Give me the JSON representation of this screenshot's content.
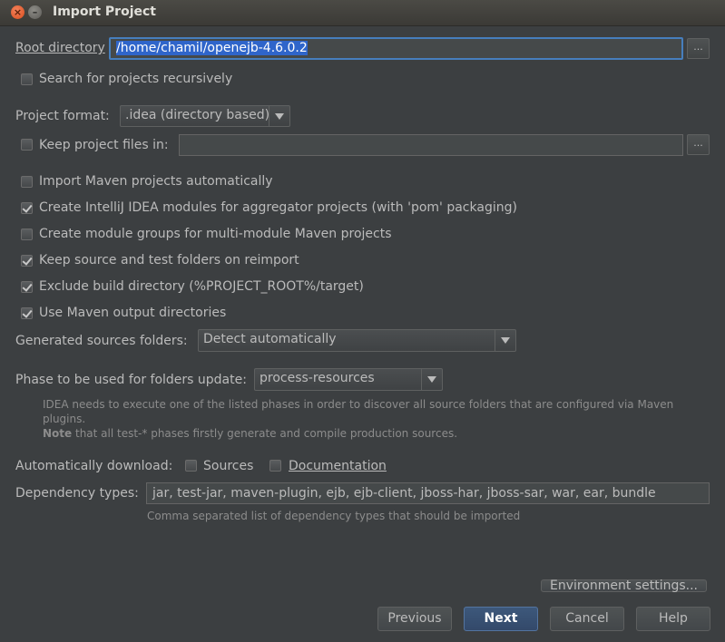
{
  "window": {
    "title": "Import Project"
  },
  "root_directory": {
    "label": "Root directory",
    "value": "/home/chamil/openejb-4.6.0.2",
    "browse_label": "..."
  },
  "search_recursively": {
    "label": "Search for projects recursively",
    "checked": false
  },
  "project_format": {
    "label": "Project format:",
    "selected": ".idea (directory based)"
  },
  "keep_project_files": {
    "label": "Keep project files in:",
    "checked": false,
    "value": "",
    "browse_label": "..."
  },
  "maven_options": [
    {
      "label": "Import Maven projects automatically",
      "checked": false
    },
    {
      "label": "Create IntelliJ IDEA modules for aggregator projects (with 'pom' packaging)",
      "checked": true
    },
    {
      "label": "Create module groups for multi-module Maven projects",
      "checked": false
    },
    {
      "label": "Keep source and test folders on reimport",
      "checked": true
    },
    {
      "label": "Exclude build directory (%PROJECT_ROOT%/target)",
      "checked": true
    },
    {
      "label": "Use Maven output directories",
      "checked": true
    }
  ],
  "generated_sources": {
    "label": "Generated sources folders:",
    "selected": "Detect automatically"
  },
  "phase": {
    "label": "Phase to be used for folders update:",
    "selected": "process-resources",
    "hint_line1": "IDEA needs to execute one of the listed phases in order to discover all source folders that are configured via Maven",
    "hint_line2": "plugins.",
    "hint_note_bold": "Note",
    "hint_note_rest": " that all test-* phases firstly generate and compile production sources."
  },
  "auto_download": {
    "label": "Automatically download:",
    "sources_label": "Sources",
    "sources_checked": false,
    "documentation_label": "Documentation",
    "documentation_checked": false
  },
  "dependency_types": {
    "label": "Dependency types:",
    "value": "jar, test-jar, maven-plugin, ejb, ejb-client, jboss-har, jboss-sar, war, ear, bundle",
    "hint": "Comma separated list of dependency types that should be imported"
  },
  "buttons": {
    "environment_settings": "Environment settings...",
    "previous": "Previous",
    "next": "Next",
    "cancel": "Cancel",
    "help": "Help"
  },
  "colors": {
    "background": "#3c3f41",
    "accent": "#467ebd",
    "selection": "#2f65ca"
  }
}
